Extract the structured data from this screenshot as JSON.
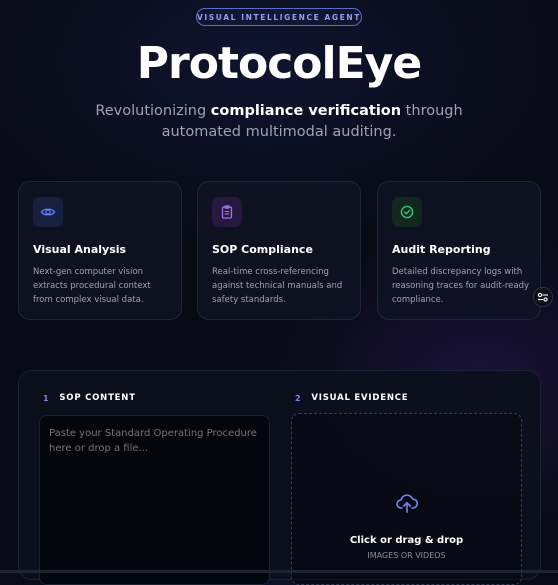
{
  "hero": {
    "badge": "VISUAL INTELLIGENCE AGENT",
    "title": "ProtocolEye",
    "subtitle_pre": "Revolutionizing ",
    "subtitle_bold": "compliance verification",
    "subtitle_post": " through automated multimodal auditing."
  },
  "features": [
    {
      "title": "Visual Analysis",
      "desc": "Next-gen computer vision extracts procedural context from complex visual data.",
      "icon": "eye-icon",
      "color": "#5b7cf0"
    },
    {
      "title": "SOP Compliance",
      "desc": "Real-time cross-referencing against technical manuals and safety standards.",
      "icon": "clipboard-icon",
      "color": "#a070f0"
    },
    {
      "title": "Audit Reporting",
      "desc": "Detailed discrepancy logs with reasoning traces for audit-ready compliance.",
      "icon": "check-circle-icon",
      "color": "#34c47a"
    }
  ],
  "input_panel": {
    "sop": {
      "step": "1",
      "label": "SOP CONTENT",
      "placeholder": "Paste your Standard Operating Procedure here or drop a file..."
    },
    "evidence": {
      "step": "2",
      "label": "VISUAL EVIDENCE",
      "drop_title": "Click or drag & drop",
      "drop_subtitle": "IMAGES OR VIDEOS",
      "icon": "upload-cloud-icon"
    }
  },
  "colors": {
    "accent": "#6f86f0",
    "background": "#080a16"
  }
}
